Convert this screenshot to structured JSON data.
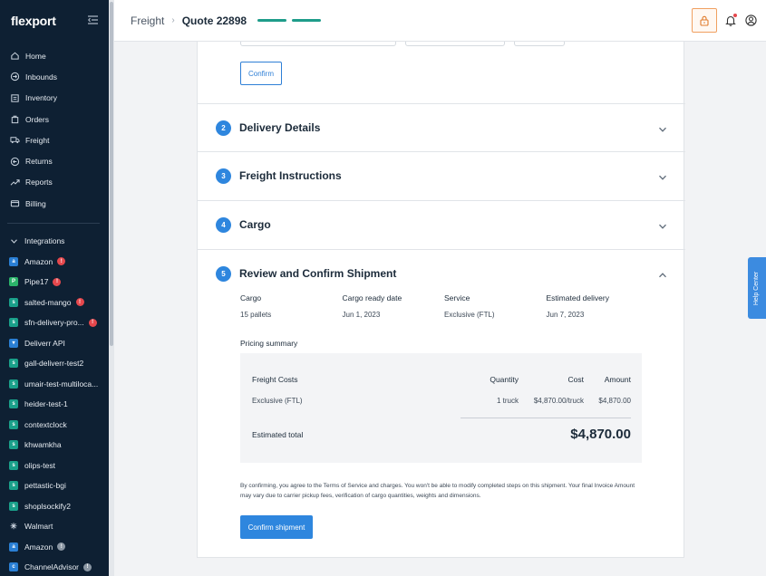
{
  "sidebar": {
    "logo": "flexport",
    "nav": [
      {
        "label": "Home",
        "icon": "home-icon"
      },
      {
        "label": "Inbounds",
        "icon": "inbound-icon"
      },
      {
        "label": "Inventory",
        "icon": "inventory-icon"
      },
      {
        "label": "Orders",
        "icon": "orders-icon"
      },
      {
        "label": "Freight",
        "icon": "truck-icon"
      },
      {
        "label": "Returns",
        "icon": "returns-icon"
      },
      {
        "label": "Reports",
        "icon": "reports-icon"
      },
      {
        "label": "Billing",
        "icon": "billing-icon"
      }
    ],
    "integrations_label": "Integrations",
    "integrations": [
      {
        "label": "Amazon",
        "alert": true
      },
      {
        "label": "Pipe17",
        "alert": true
      },
      {
        "label": "salted-mango",
        "alert": true
      },
      {
        "label": "sfn-delivery-pro...",
        "alert": true
      },
      {
        "label": "Deliverr API",
        "alert": false
      },
      {
        "label": "gall-deliverr-test2",
        "alert": false
      },
      {
        "label": "umair-test-multiloca...",
        "alert": false
      },
      {
        "label": "heider-test-1",
        "alert": false
      },
      {
        "label": "contextclock",
        "alert": false
      },
      {
        "label": "khwamkha",
        "alert": false
      },
      {
        "label": "olips-test",
        "alert": false
      },
      {
        "label": "pettastic-bgi",
        "alert": false
      },
      {
        "label": "shoplsockify2",
        "alert": false
      },
      {
        "label": "Walmart",
        "alert": false
      },
      {
        "label": "Amazon",
        "alert": "grey"
      },
      {
        "label": "ChannelAdvisor",
        "alert": "grey"
      }
    ]
  },
  "header": {
    "crumb_root": "Freight",
    "crumb_current": "Quote 22898"
  },
  "form": {
    "confirm_label": "Confirm",
    "steps": [
      {
        "num": "2",
        "title": "Delivery Details"
      },
      {
        "num": "3",
        "title": "Freight Instructions"
      },
      {
        "num": "4",
        "title": "Cargo"
      },
      {
        "num": "5",
        "title": "Review and Confirm Shipment"
      }
    ],
    "summary": {
      "headers": [
        "Cargo",
        "Cargo ready date",
        "Service",
        "Estimated delivery"
      ],
      "values": [
        "15 pallets",
        "Jun 1, 2023",
        "Exclusive (FTL)",
        "Jun 7, 2023"
      ]
    },
    "pricing_label": "Pricing summary",
    "pricing": {
      "col_item": "Freight Costs",
      "col_qty": "Quantity",
      "col_cost": "Cost",
      "col_amount": "Amount",
      "row_item": "Exclusive (FTL)",
      "row_qty": "1 truck",
      "row_cost": "$4,870.00/truck",
      "row_amount": "$4,870.00",
      "total_label": "Estimated total",
      "total_amount": "$4,870.00"
    },
    "disclaimer": "By confirming, you agree to the Terms of Service and charges. You won't be able to modify completed steps on this shipment. Your final Invoice Amount may vary due to carrier pickup fees, verification of cargo quantities, weights and dimensions.",
    "confirm_shipment_label": "Confirm shipment"
  },
  "help_label": "Help Center",
  "colors": {
    "sidebar_bg": "#0e2033",
    "accent": "#2e86de",
    "progress": "#1e9c8a",
    "alert": "#e5484d"
  }
}
